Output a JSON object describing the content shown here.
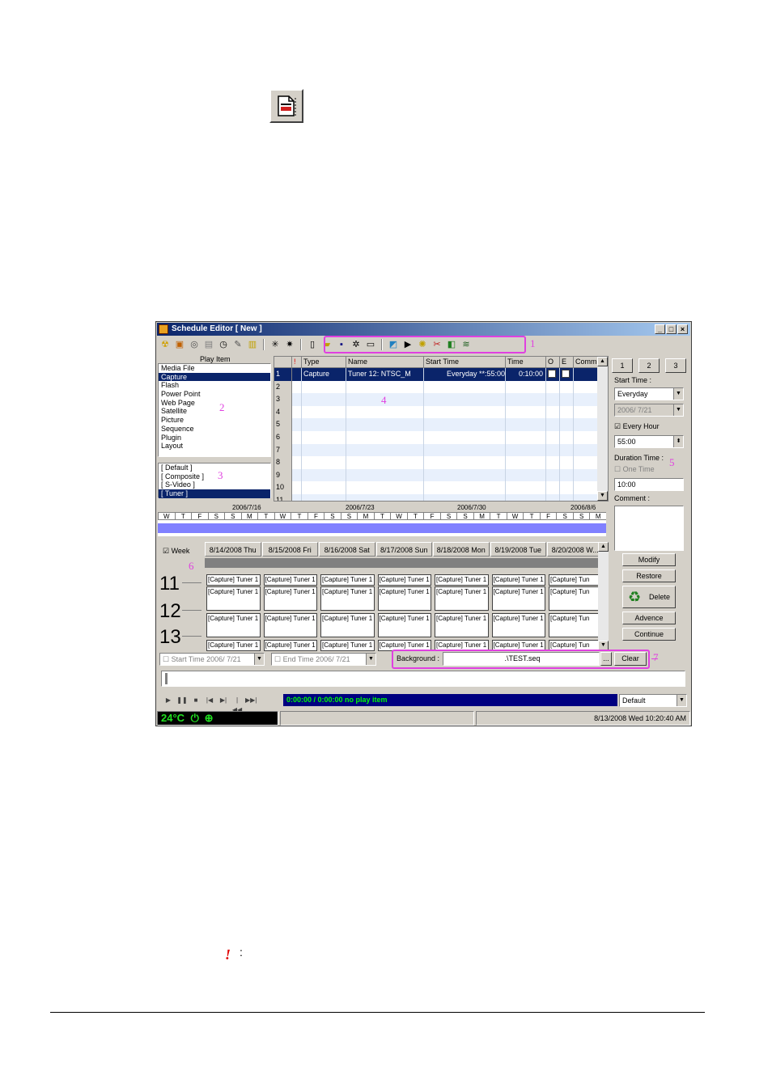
{
  "window": {
    "title": "Schedule Editor [ New ]",
    "controls": [
      "_",
      "□",
      "×"
    ]
  },
  "callouts": [
    "1",
    "2",
    "3",
    "4",
    "5",
    "6",
    "7"
  ],
  "play_item": {
    "header": "Play Item",
    "items": [
      "Media File",
      "Capture",
      "Flash",
      "Power Point",
      "Web Page",
      "Satellite",
      "Picture",
      "Sequence",
      "Plugin",
      "Layout"
    ],
    "selected": "Capture"
  },
  "sources": {
    "items": [
      "[ Default ]",
      "[ Composite ]",
      "[ S-Video ]",
      "[ Tuner ]"
    ],
    "selected": "[ Tuner ]"
  },
  "grid": {
    "columns": [
      "",
      "!",
      "Type",
      "Name",
      "Start Time",
      "Time",
      "O",
      "E",
      "Comm"
    ],
    "rows": [
      {
        "n": "1",
        "type": "Capture",
        "name": "Tuner 12: NTSC_M",
        "start": "Everyday **:55:00",
        "time": "0:10:00"
      },
      {
        "n": "2"
      },
      {
        "n": "3"
      },
      {
        "n": "4"
      },
      {
        "n": "5"
      },
      {
        "n": "6"
      },
      {
        "n": "7"
      },
      {
        "n": "8"
      },
      {
        "n": "9"
      },
      {
        "n": "10"
      },
      {
        "n": "11"
      }
    ]
  },
  "side": {
    "tab_buttons": [
      "1",
      "2",
      "3"
    ],
    "start_time_label": "Start Time :",
    "start_mode": "Everyday",
    "start_date": "2006/ 7/21",
    "every_hour_label": "Every Hour",
    "every_hour_value": "55:00",
    "duration_label": "Duration Time :",
    "one_time_label": "One Time",
    "duration_value": "10:00",
    "comment_label": "Comment :",
    "buttons": [
      "Modify",
      "Restore",
      "Delete",
      "Advence",
      "Continue"
    ]
  },
  "timeline": {
    "dates": [
      "2006/7/16",
      "2006/7/23",
      "2006/7/30",
      "2006/8/6"
    ],
    "days": [
      "W",
      "T",
      "F",
      "S",
      "S",
      "M",
      "T",
      "W",
      "T",
      "F",
      "S",
      "S",
      "M",
      "T",
      "W",
      "T",
      "F",
      "S",
      "S",
      "M",
      "T",
      "W",
      "T",
      "F",
      "S",
      "S",
      "M"
    ]
  },
  "week": {
    "week_label": "Week",
    "days": [
      "8/14/2008 Thu",
      "8/15/2008 Fri",
      "8/16/2008 Sat",
      "8/17/2008 Sun",
      "8/18/2008 Mon",
      "8/19/2008 Tue",
      "8/20/2008 W..."
    ],
    "hours": [
      "11",
      "12",
      "13"
    ],
    "cell_text": "[Capture] Tuner 1",
    "cell_text_last": "[Capture] Tun"
  },
  "filters": {
    "start_time": "Start Time 2006/ 7/21",
    "end_time": "End Time 2006/ 7/21"
  },
  "background": {
    "label": "Background :",
    "value": ".\\TEST.seq",
    "browse": "...",
    "clear": "Clear"
  },
  "player": {
    "status": "0:00:00 / 0:00:00  no play item",
    "preset": "Default",
    "transport": [
      "▶",
      "❚❚",
      "■",
      "|◀",
      "▶|",
      "|◀◀",
      "▶▶|"
    ]
  },
  "statusbar": {
    "temp": "24°C",
    "datetime": "8/13/2008 Wed 10:20:40 AM"
  },
  "colors": {
    "highlight": "#e040e0",
    "titlebar": "#0a246a",
    "timeline_bar": "#8080ff"
  }
}
